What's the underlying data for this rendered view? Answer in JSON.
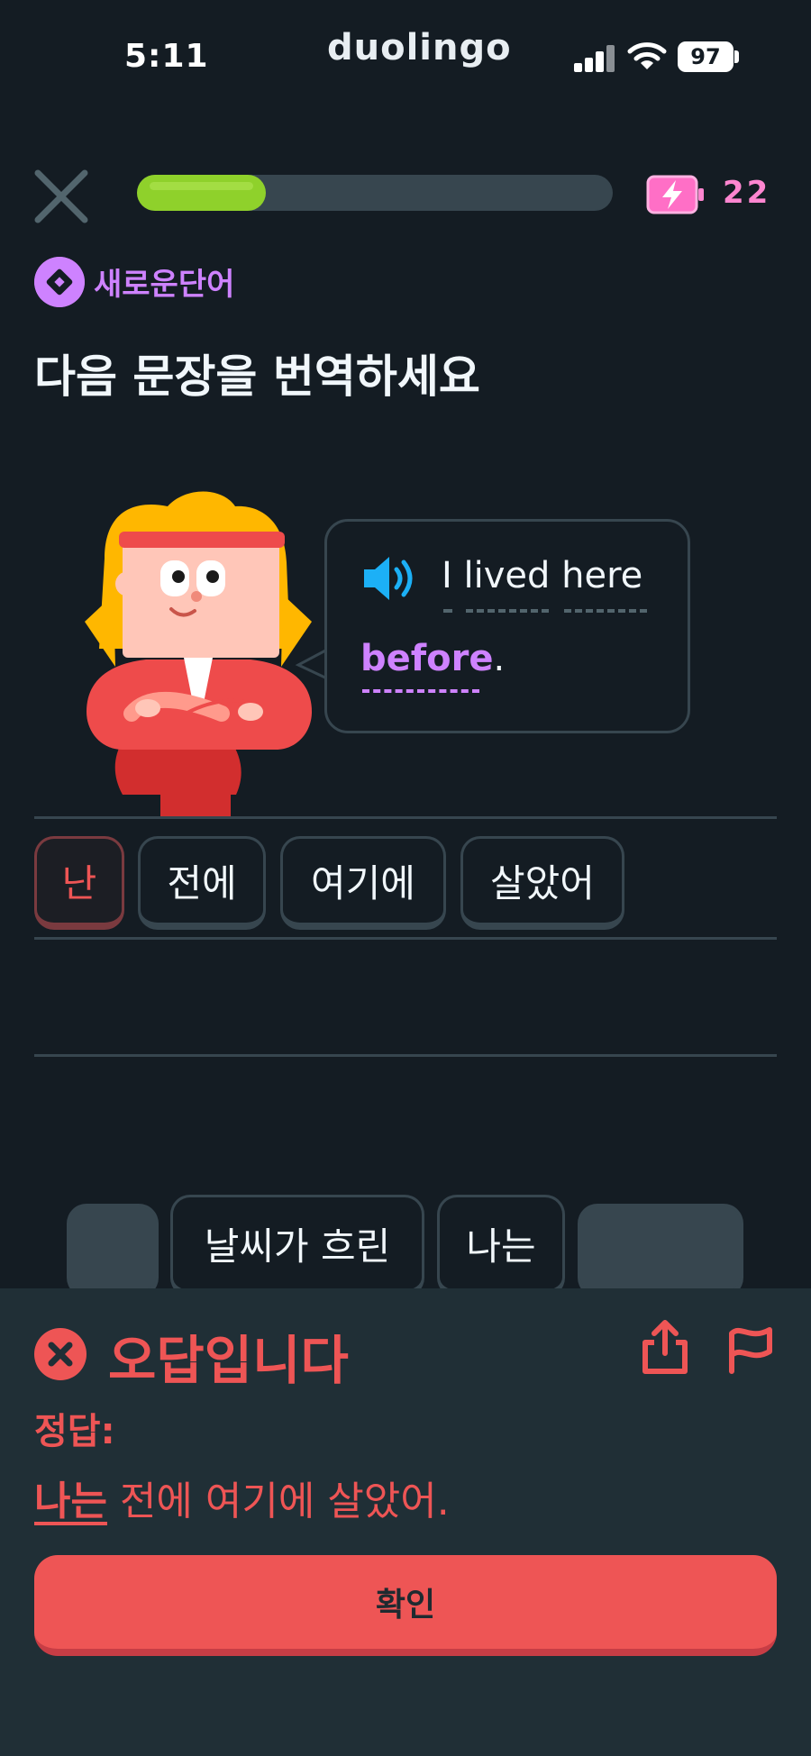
{
  "status_bar": {
    "time": "5:11",
    "app_name": "duolingo",
    "battery": "97"
  },
  "top_bar": {
    "progress": 0.27,
    "energy_count": "22"
  },
  "badge": {
    "label": "새로운단어"
  },
  "title": "다음 문장을 번역하세요",
  "prompt": {
    "text_line1": "I lived here",
    "new_word": "before",
    "punct": "."
  },
  "answer_tiles": [
    "난",
    "전에",
    "여기에",
    "살았어"
  ],
  "word_bank": {
    "visible_tiles": [
      "날씨가 흐린",
      "나는"
    ]
  },
  "feedback": {
    "title": "오답입니다",
    "label": "정답:",
    "answer_highlight": "나는",
    "answer_rest": " 전에 여기에 살았어.",
    "button": "확인"
  },
  "colors": {
    "error": "#ee5555",
    "accent_purple": "#ce82ff",
    "progress_green": "#8fd12b",
    "energy_pink": "#ff86d0"
  }
}
